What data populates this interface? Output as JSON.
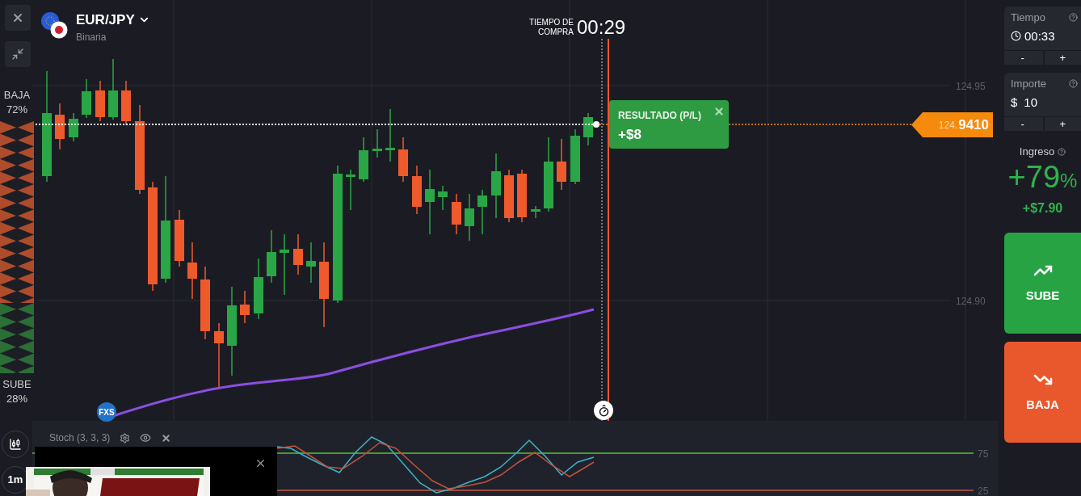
{
  "asset": {
    "name": "EUR/JPY",
    "type": "Binaria"
  },
  "purchase_timer": {
    "label_lines": [
      "TIEMPO DE",
      "COMPRA"
    ],
    "time": "00:29"
  },
  "sentiment": [
    {
      "label": "BAJA",
      "percent": "72%",
      "level": 0.72
    },
    {
      "label": "SUBE",
      "percent": "28%",
      "level": 0.28
    }
  ],
  "price_axis": [
    "124.95",
    "124.90"
  ],
  "current_price": {
    "prefix": "124.",
    "main": "9410"
  },
  "result": {
    "title": "RESULTADO (P/L)",
    "value": "+$8"
  },
  "source_badge": "FXS",
  "indicator": {
    "name": "Stoch (3, 3, 3)",
    "axis": [
      "75",
      "25"
    ]
  },
  "timeframe": "1m",
  "panel": {
    "time": {
      "label": "Tiempo",
      "value": "00:33",
      "minus": "-",
      "plus": "+"
    },
    "amount": {
      "label": "Importe",
      "currency": "$",
      "value": "10",
      "minus": "-",
      "plus": "+"
    },
    "payout": {
      "label": "Ingreso",
      "percent": "+79",
      "percent_sign": "%",
      "profit": "+$7.90"
    },
    "actions": [
      {
        "kind": "up",
        "label": "SUBE"
      },
      {
        "kind": "down",
        "label": "BAJA"
      }
    ]
  }
}
